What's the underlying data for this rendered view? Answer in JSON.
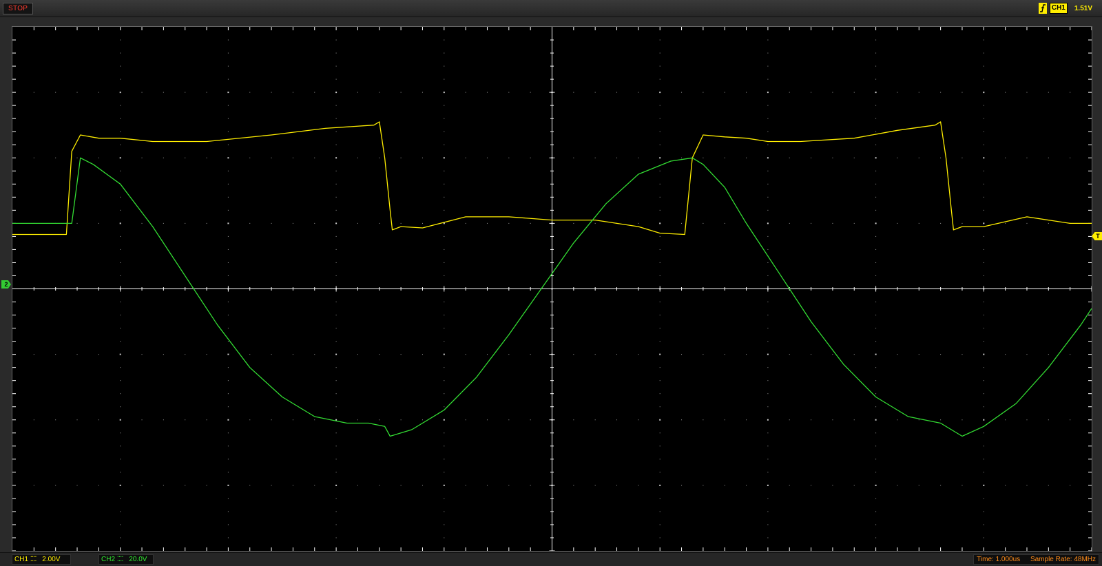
{
  "top_bar": {
    "status": "STOP",
    "trigger": {
      "edge_icon": "rising-edge-icon",
      "channel": "CH1",
      "level": "1.51V"
    }
  },
  "markers": {
    "ch2_ground": "2",
    "trigger": "T"
  },
  "bottom_bar": {
    "ch1": {
      "label": "CH1",
      "coupling": "⁚⁚⁚⁚",
      "scale": "2.00V"
    },
    "ch2": {
      "label": "CH2",
      "coupling": "⁚⁚⁚⁚",
      "scale": "20.0V"
    },
    "time": "Time: 1.000us",
    "sample_rate": "Sample Rate: 48MHz"
  },
  "colors": {
    "ch1": "#ffee00",
    "ch2": "#33dd33",
    "grid": "#ffffff",
    "status": "#ff3b2f",
    "timebase": "#ff8c1a"
  },
  "chart_data": {
    "type": "line",
    "grid": {
      "horizontal_divisions": 8,
      "vertical_divisions": 10
    },
    "xlim": [
      0,
      10
    ],
    "ylim": [
      -4,
      4
    ],
    "series": [
      {
        "name": "CH1",
        "color": "#ffee00",
        "points": [
          [
            0.0,
            0.83
          ],
          [
            0.5,
            0.83
          ],
          [
            0.55,
            2.1
          ],
          [
            0.63,
            2.35
          ],
          [
            0.8,
            2.3
          ],
          [
            1.0,
            2.3
          ],
          [
            1.3,
            2.25
          ],
          [
            1.8,
            2.25
          ],
          [
            2.4,
            2.35
          ],
          [
            2.9,
            2.45
          ],
          [
            3.35,
            2.5
          ],
          [
            3.4,
            2.55
          ],
          [
            3.45,
            2.0
          ],
          [
            3.5,
            1.2
          ],
          [
            3.52,
            0.9
          ],
          [
            3.6,
            0.95
          ],
          [
            3.8,
            0.93
          ],
          [
            4.2,
            1.1
          ],
          [
            4.6,
            1.1
          ],
          [
            5.0,
            1.05
          ],
          [
            5.4,
            1.05
          ],
          [
            5.8,
            0.95
          ],
          [
            6.0,
            0.85
          ],
          [
            6.23,
            0.83
          ],
          [
            6.3,
            2.0
          ],
          [
            6.4,
            2.35
          ],
          [
            6.6,
            2.32
          ],
          [
            6.8,
            2.3
          ],
          [
            7.0,
            2.25
          ],
          [
            7.3,
            2.25
          ],
          [
            7.8,
            2.3
          ],
          [
            8.2,
            2.42
          ],
          [
            8.55,
            2.5
          ],
          [
            8.6,
            2.55
          ],
          [
            8.65,
            2.0
          ],
          [
            8.7,
            1.2
          ],
          [
            8.72,
            0.9
          ],
          [
            8.8,
            0.95
          ],
          [
            9.0,
            0.95
          ],
          [
            9.4,
            1.1
          ],
          [
            9.8,
            1.0
          ],
          [
            10.0,
            1.0
          ]
        ]
      },
      {
        "name": "CH2",
        "color": "#33dd33",
        "points": [
          [
            0.0,
            1.0
          ],
          [
            0.2,
            1.0
          ],
          [
            0.4,
            1.0
          ],
          [
            0.55,
            1.0
          ],
          [
            0.63,
            2.0
          ],
          [
            0.75,
            1.9
          ],
          [
            1.0,
            1.6
          ],
          [
            1.3,
            0.95
          ],
          [
            1.6,
            0.2
          ],
          [
            1.9,
            -0.55
          ],
          [
            2.2,
            -1.2
          ],
          [
            2.5,
            -1.65
          ],
          [
            2.8,
            -1.95
          ],
          [
            3.1,
            -2.05
          ],
          [
            3.3,
            -2.05
          ],
          [
            3.45,
            -2.1
          ],
          [
            3.5,
            -2.25
          ],
          [
            3.7,
            -2.15
          ],
          [
            4.0,
            -1.85
          ],
          [
            4.3,
            -1.35
          ],
          [
            4.6,
            -0.7
          ],
          [
            4.9,
            0.0
          ],
          [
            5.2,
            0.7
          ],
          [
            5.5,
            1.3
          ],
          [
            5.8,
            1.75
          ],
          [
            6.1,
            1.95
          ],
          [
            6.3,
            2.0
          ],
          [
            6.4,
            1.9
          ],
          [
            6.6,
            1.55
          ],
          [
            6.8,
            1.0
          ],
          [
            7.1,
            0.25
          ],
          [
            7.4,
            -0.5
          ],
          [
            7.7,
            -1.15
          ],
          [
            8.0,
            -1.65
          ],
          [
            8.3,
            -1.95
          ],
          [
            8.6,
            -2.05
          ],
          [
            8.7,
            -2.15
          ],
          [
            8.8,
            -2.25
          ],
          [
            9.0,
            -2.1
          ],
          [
            9.3,
            -1.75
          ],
          [
            9.6,
            -1.2
          ],
          [
            9.9,
            -0.55
          ],
          [
            10.0,
            -0.3
          ]
        ]
      }
    ]
  }
}
